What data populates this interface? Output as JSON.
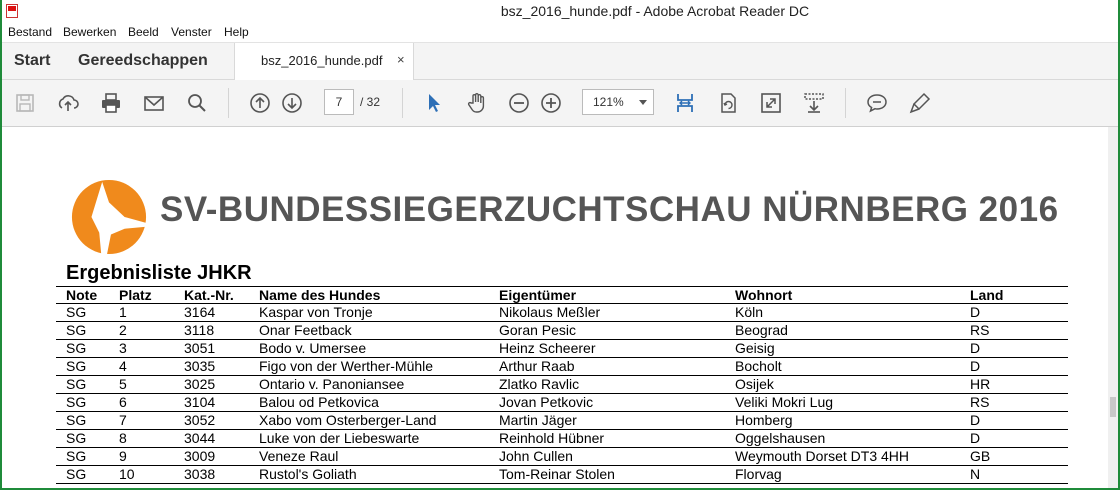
{
  "window": {
    "title": "bsz_2016_hunde.pdf - Adobe Acrobat Reader DC"
  },
  "menu": [
    "Bestand",
    "Bewerken",
    "Beeld",
    "Venster",
    "Help"
  ],
  "tabs": {
    "start": "Start",
    "tools": "Gereedschappen",
    "document": "bsz_2016_hunde.pdf",
    "close": "×"
  },
  "toolbar": {
    "page_current": "7",
    "page_total": "/ 32",
    "zoom": "121%",
    "icons": [
      "save-icon",
      "upload-icon",
      "print-icon",
      "mail-icon",
      "search-icon",
      "page-up-icon",
      "page-down-icon",
      "select-cursor-icon",
      "hand-icon",
      "zoom-out-icon",
      "zoom-in-icon",
      "fit-width-icon",
      "rotate-page-icon",
      "fullscreen-icon",
      "scroll-mode-icon",
      "comment-icon",
      "highlight-pen-icon"
    ],
    "accent": "#2d6fb6"
  },
  "document": {
    "headline": "SV-BUNDESSIEGERZUCHTSCHAU  NÜRNBERG 2016",
    "subtitle": "Ergebnisliste  JHKR",
    "logo_color": "#f08a1c",
    "columns": [
      "Note",
      "Platz",
      "Kat.-Nr.",
      "Name des Hundes",
      "Eigentümer",
      "Wohnort",
      "Land"
    ],
    "rows": [
      [
        "SG",
        "1",
        "3164",
        "Kaspar von Tronje",
        "Nikolaus Meßler",
        "Köln",
        "D"
      ],
      [
        "SG",
        "2",
        "3118",
        "Onar Feetback",
        "Goran Pesic",
        "Beograd",
        "RS"
      ],
      [
        "SG",
        "3",
        "3051",
        "Bodo v. Umersee",
        "Heinz Scheerer",
        "Geisig",
        "D"
      ],
      [
        "SG",
        "4",
        "3035",
        "Figo von der Werther-Mühle",
        "Arthur Raab",
        "Bocholt",
        "D"
      ],
      [
        "SG",
        "5",
        "3025",
        "Ontario v. Panoniansee",
        "Zlatko Ravlic",
        "Osijek",
        "HR"
      ],
      [
        "SG",
        "6",
        "3104",
        "Balou od Petkovica",
        "Jovan Petkovic",
        "Veliki Mokri Lug",
        "RS"
      ],
      [
        "SG",
        "7",
        "3052",
        "Xabo vom Osterberger-Land",
        "Martin Jäger",
        "Homberg",
        "D"
      ],
      [
        "SG",
        "8",
        "3044",
        "Luke von der Liebeswarte",
        "Reinhold Hübner",
        "Oggelshausen",
        "D"
      ],
      [
        "SG",
        "9",
        "3009",
        "Veneze Raul",
        "John Cullen",
        "Weymouth Dorset DT3 4HH",
        "GB"
      ],
      [
        "SG",
        "10",
        "3038",
        "Rustol's Goliath",
        "Tom-Reinar Stolen",
        "Florvag",
        "N"
      ]
    ]
  }
}
